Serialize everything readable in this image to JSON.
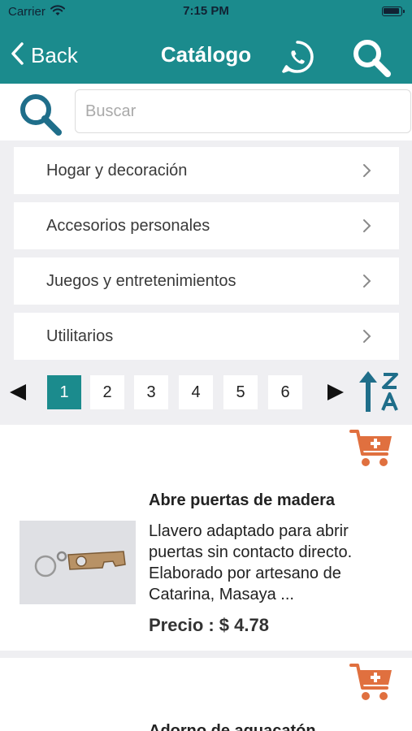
{
  "status_bar": {
    "carrier": "Carrier",
    "time": "7:15 PM"
  },
  "nav": {
    "back_label": "Back",
    "title": "Catálogo",
    "icons": [
      "chevron-left-icon",
      "whatsapp-icon",
      "search-icon"
    ]
  },
  "search": {
    "placeholder": "Buscar",
    "value": ""
  },
  "categories": [
    {
      "label": "Hogar y decoración"
    },
    {
      "label": "Accesorios personales"
    },
    {
      "label": "Juegos y entretenimientos"
    },
    {
      "label": "Utilitarios"
    }
  ],
  "pagination": {
    "pages": [
      "1",
      "2",
      "3",
      "4",
      "5",
      "6"
    ],
    "current": "1"
  },
  "colors": {
    "primary": "#1b8b8d",
    "accent": "#e0703f",
    "background": "#efeff2"
  },
  "products": [
    {
      "name": "Abre puertas de madera",
      "description": "Llavero adaptado para abrir puertas sin contacto directo. Elaborado por artesano de Catarina, Masaya ...",
      "price": "Precio : $ 4.78"
    },
    {
      "name": "Adorno de aguacatón",
      "description": "",
      "price": ""
    }
  ]
}
